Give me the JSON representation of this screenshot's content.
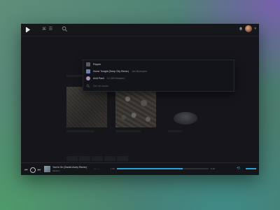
{
  "colors": {
    "accent": "#2aa3d8",
    "window_bg": "#1b1c20",
    "topbar_bg": "#16171a"
  },
  "topbar": {
    "logo_icon": "app-logo-icon",
    "menu_glyphs": "⌘ ☰",
    "search_icon": "search-icon",
    "user_chevron": "▾"
  },
  "search_dropdown": {
    "results": [
      {
        "title": "Pepper",
        "subtitle": "",
        "thumb_color": "#555"
      },
      {
        "title": "Home Tonight (Deep City Remix)",
        "subtitle": "Jan Blomqvist",
        "thumb_color": "#6b7fb3"
      },
      {
        "title": "Acid Pauli",
        "subtitle": "12,345 followers",
        "thumb_color": "#a78fb3"
      }
    ],
    "footer": "See all results"
  },
  "player": {
    "prev": "⏮",
    "play": "",
    "next": "⏭",
    "track_title": "You're On (Daniel Avery Remix)",
    "artist": "Madeon",
    "actions": "♡ ⋯",
    "time_elapsed": "1:36",
    "time_total": "5:18",
    "progress": 0.72,
    "repeat": "⟲",
    "volume": 1.0
  }
}
